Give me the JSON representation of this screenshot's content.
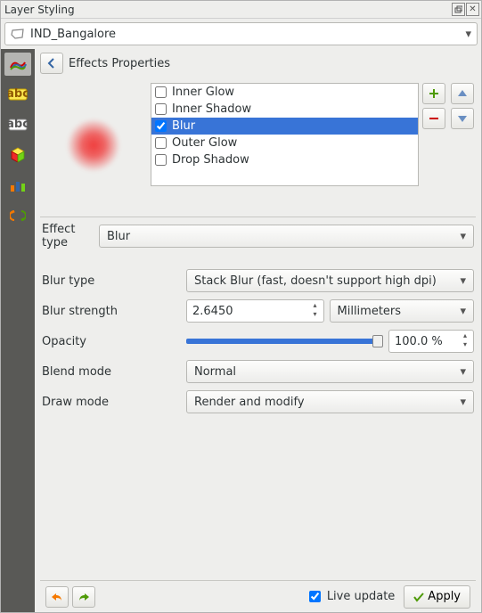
{
  "title": "Layer Styling",
  "layer_name": "IND_Bangalore",
  "header_label": "Effects Properties",
  "effects": {
    "items": [
      {
        "label": "Inner Glow",
        "checked": false
      },
      {
        "label": "Inner Shadow",
        "checked": false
      },
      {
        "label": "Blur",
        "checked": true,
        "selected": true
      },
      {
        "label": "Outer Glow",
        "checked": false
      },
      {
        "label": "Drop Shadow",
        "checked": false
      }
    ]
  },
  "form": {
    "effect_type_label": "Effect type",
    "effect_type_value": "Blur",
    "blur_type_label": "Blur type",
    "blur_type_value": "Stack Blur (fast, doesn't support high dpi)",
    "blur_strength_label": "Blur strength",
    "blur_strength_value": "2.6450",
    "blur_strength_unit": "Millimeters",
    "opacity_label": "Opacity",
    "opacity_value": "100.0 %",
    "blend_mode_label": "Blend mode",
    "blend_mode_value": "Normal",
    "draw_mode_label": "Draw mode",
    "draw_mode_value": "Render and modify"
  },
  "footer": {
    "live_update_label": "Live update",
    "apply_label": "Apply"
  }
}
